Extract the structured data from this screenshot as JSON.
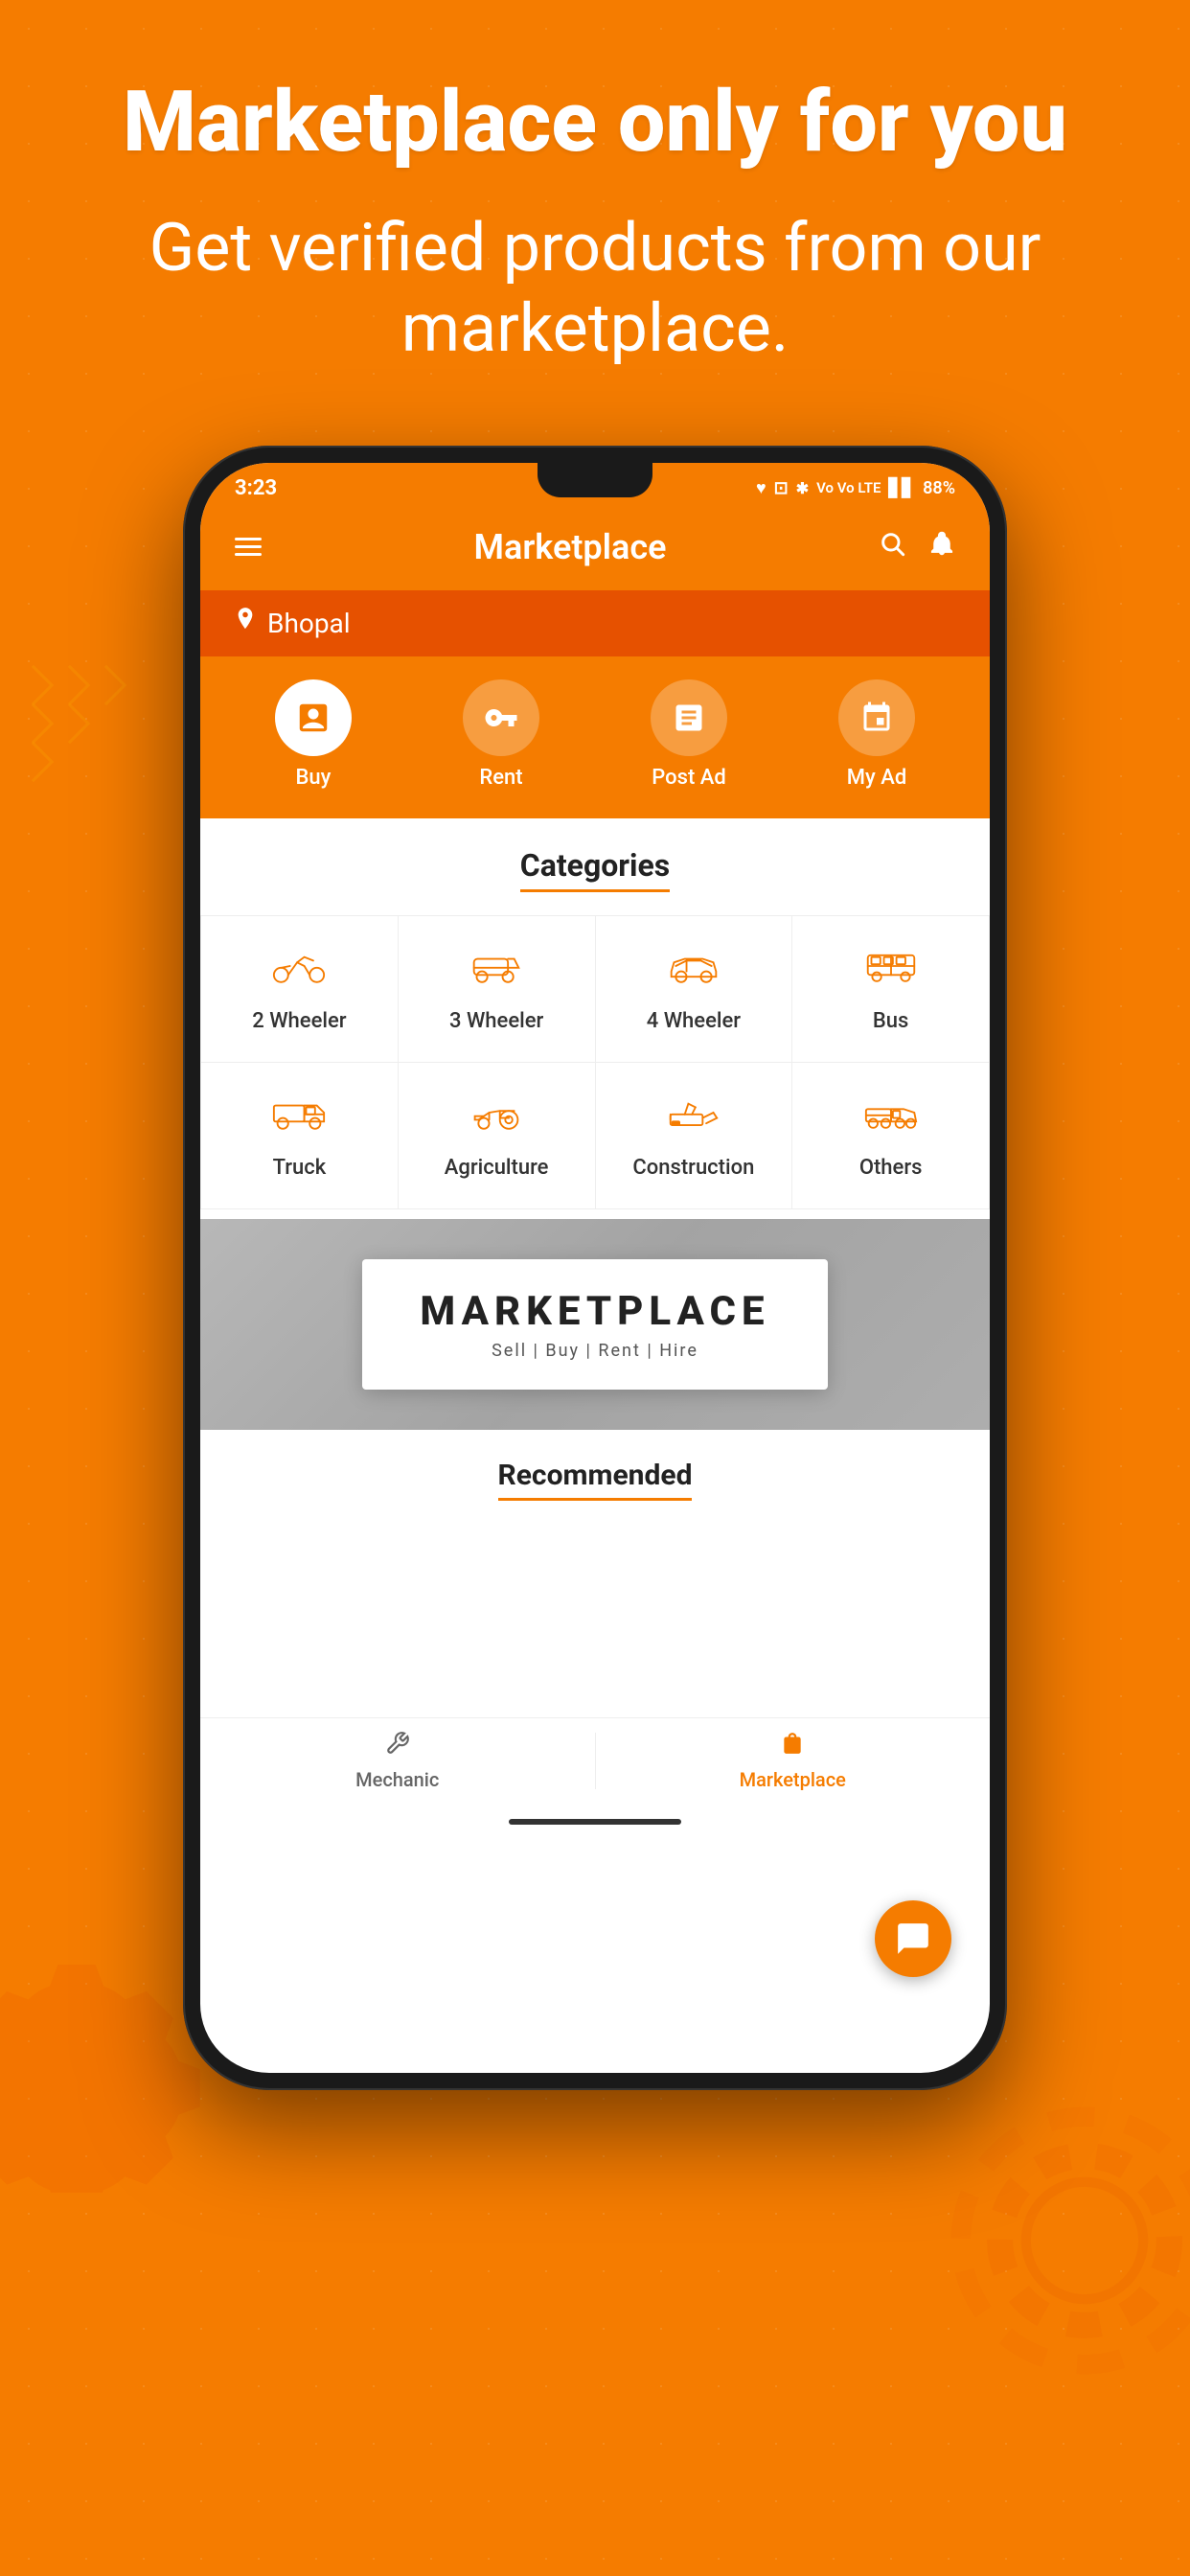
{
  "page": {
    "bg_color": "#F57C00",
    "hero_title": "Marketplace only for you",
    "hero_subtitle": "Get verified products from our marketplace."
  },
  "phone": {
    "status_bar": {
      "time": "3:23",
      "battery": "88%",
      "icons": "♥ 🖼 ✱ Vo Vo LTE"
    },
    "header": {
      "title": "Marketplace",
      "menu_icon": "☰",
      "search_icon": "🔍",
      "bell_icon": "🔔"
    },
    "location": {
      "city": "Bhopal",
      "pin_icon": "📍"
    },
    "quick_actions": [
      {
        "id": "buy",
        "label": "Buy",
        "icon": "💰",
        "active": true
      },
      {
        "id": "rent",
        "label": "Rent",
        "icon": "🔑",
        "active": false
      },
      {
        "id": "post_ad",
        "label": "Post Ad",
        "icon": "📋",
        "active": false
      },
      {
        "id": "my_ad",
        "label": "My Ad",
        "icon": "📌",
        "active": false
      }
    ],
    "categories": {
      "title": "Categories",
      "items": [
        {
          "id": "2wheeler",
          "label": "2 Wheeler",
          "icon_type": "motorcycle"
        },
        {
          "id": "3wheeler",
          "label": "3 Wheeler",
          "icon_type": "threewheeler"
        },
        {
          "id": "4wheeler",
          "label": "4 Wheeler",
          "icon_type": "car"
        },
        {
          "id": "bus",
          "label": "Bus",
          "icon_type": "bus"
        },
        {
          "id": "truck",
          "label": "Truck",
          "icon_type": "truck"
        },
        {
          "id": "agriculture",
          "label": "Agriculture",
          "icon_type": "tractor"
        },
        {
          "id": "construction",
          "label": "Construction",
          "icon_type": "excavator"
        },
        {
          "id": "others",
          "label": "Others",
          "icon_type": "others"
        }
      ]
    },
    "banner": {
      "title": "MARKETPLACE",
      "subtitle": "Sell | Buy | Rent | Hire"
    },
    "recommended": {
      "title": "Recommended"
    },
    "fab": {
      "icon": "💬"
    },
    "bottom_nav": [
      {
        "id": "mechanic",
        "label": "Mechanic",
        "icon": "🔧",
        "active": false
      },
      {
        "id": "marketplace",
        "label": "Marketplace",
        "icon": "🛒",
        "active": true
      }
    ]
  }
}
